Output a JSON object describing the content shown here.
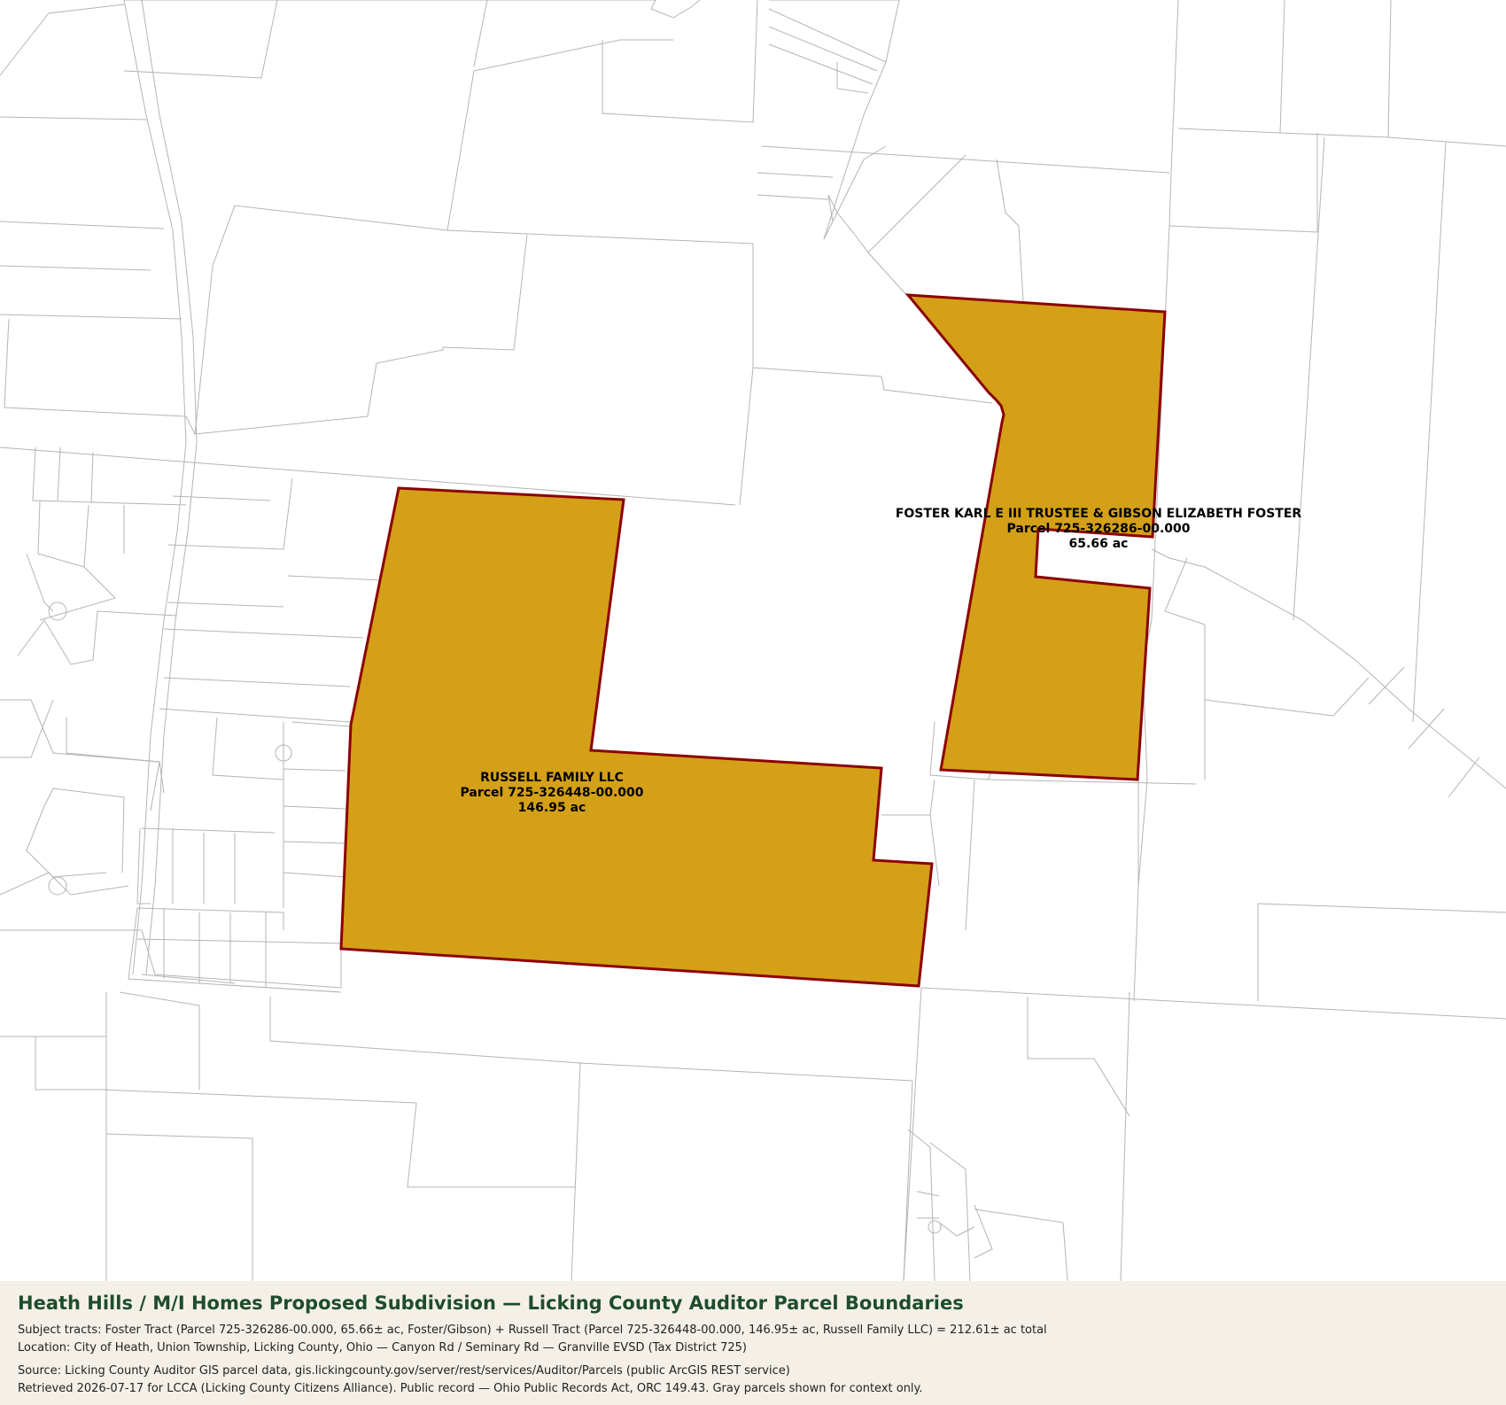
{
  "colors": {
    "subject_fill": "#d4a017",
    "subject_stroke": "#8b0000",
    "context_stroke": "#b4b4b4",
    "footer_bg": "#f4f0e8",
    "title_color": "#1e4d2b"
  },
  "parcels": {
    "foster": {
      "owner": "FOSTER KARL E III TRUSTEE & GIBSON ELIZABETH FOSTER",
      "parcel": "Parcel 725-326286-00.000",
      "acres": "65.66 ac"
    },
    "russell": {
      "owner": "RUSSELL FAMILY LLC",
      "parcel": "Parcel 725-326448-00.000",
      "acres": "146.95 ac"
    }
  },
  "footer": {
    "title": "Heath Hills / M/I Homes Proposed Subdivision — Licking County Auditor Parcel Boundaries",
    "subject_line": "Subject tracts: Foster Tract (Parcel 725-326286-00.000, 65.66± ac, Foster/Gibson) + Russell Tract (Parcel 725-326448-00.000, 146.95± ac, Russell Family LLC) = 212.61± ac total",
    "location_line": "Location: City of Heath, Union Township, Licking County, Ohio — Canyon Rd / Seminary Rd — Granville EVSD (Tax District 725)",
    "source_line": "Source: Licking County Auditor GIS parcel data, gis.lickingcounty.gov/server/rest/services/Auditor/Parcels (public ArcGIS REST service)",
    "retrieved_line": "Retrieved 2026-07-17 for LCCA (Licking County Citizens Alliance). Public record — Ohio Public Records Act, ORC 149.43. Gray parcels shown for context only."
  }
}
